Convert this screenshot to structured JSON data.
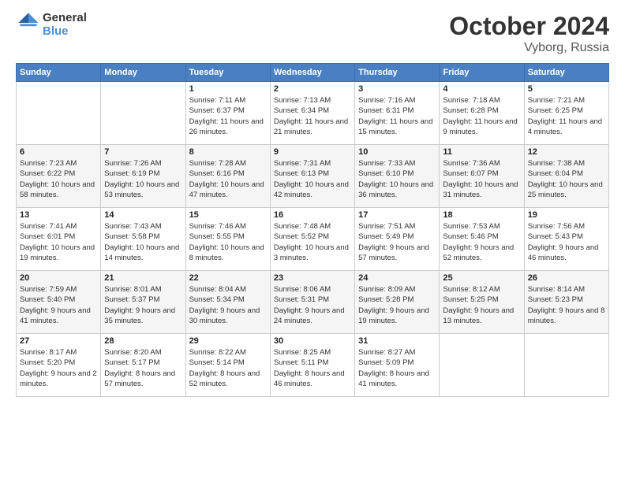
{
  "header": {
    "logo_line1": "General",
    "logo_line2": "Blue",
    "month": "October 2024",
    "location": "Vyborg, Russia"
  },
  "weekdays": [
    "Sunday",
    "Monday",
    "Tuesday",
    "Wednesday",
    "Thursday",
    "Friday",
    "Saturday"
  ],
  "weeks": [
    [
      {
        "day": "",
        "info": ""
      },
      {
        "day": "",
        "info": ""
      },
      {
        "day": "1",
        "info": "Sunrise: 7:11 AM\nSunset: 6:37 PM\nDaylight: 11 hours and 26 minutes."
      },
      {
        "day": "2",
        "info": "Sunrise: 7:13 AM\nSunset: 6:34 PM\nDaylight: 11 hours and 21 minutes."
      },
      {
        "day": "3",
        "info": "Sunrise: 7:16 AM\nSunset: 6:31 PM\nDaylight: 11 hours and 15 minutes."
      },
      {
        "day": "4",
        "info": "Sunrise: 7:18 AM\nSunset: 6:28 PM\nDaylight: 11 hours and 9 minutes."
      },
      {
        "day": "5",
        "info": "Sunrise: 7:21 AM\nSunset: 6:25 PM\nDaylight: 11 hours and 4 minutes."
      }
    ],
    [
      {
        "day": "6",
        "info": "Sunrise: 7:23 AM\nSunset: 6:22 PM\nDaylight: 10 hours and 58 minutes."
      },
      {
        "day": "7",
        "info": "Sunrise: 7:26 AM\nSunset: 6:19 PM\nDaylight: 10 hours and 53 minutes."
      },
      {
        "day": "8",
        "info": "Sunrise: 7:28 AM\nSunset: 6:16 PM\nDaylight: 10 hours and 47 minutes."
      },
      {
        "day": "9",
        "info": "Sunrise: 7:31 AM\nSunset: 6:13 PM\nDaylight: 10 hours and 42 minutes."
      },
      {
        "day": "10",
        "info": "Sunrise: 7:33 AM\nSunset: 6:10 PM\nDaylight: 10 hours and 36 minutes."
      },
      {
        "day": "11",
        "info": "Sunrise: 7:36 AM\nSunset: 6:07 PM\nDaylight: 10 hours and 31 minutes."
      },
      {
        "day": "12",
        "info": "Sunrise: 7:38 AM\nSunset: 6:04 PM\nDaylight: 10 hours and 25 minutes."
      }
    ],
    [
      {
        "day": "13",
        "info": "Sunrise: 7:41 AM\nSunset: 6:01 PM\nDaylight: 10 hours and 19 minutes."
      },
      {
        "day": "14",
        "info": "Sunrise: 7:43 AM\nSunset: 5:58 PM\nDaylight: 10 hours and 14 minutes."
      },
      {
        "day": "15",
        "info": "Sunrise: 7:46 AM\nSunset: 5:55 PM\nDaylight: 10 hours and 8 minutes."
      },
      {
        "day": "16",
        "info": "Sunrise: 7:48 AM\nSunset: 5:52 PM\nDaylight: 10 hours and 3 minutes."
      },
      {
        "day": "17",
        "info": "Sunrise: 7:51 AM\nSunset: 5:49 PM\nDaylight: 9 hours and 57 minutes."
      },
      {
        "day": "18",
        "info": "Sunrise: 7:53 AM\nSunset: 5:46 PM\nDaylight: 9 hours and 52 minutes."
      },
      {
        "day": "19",
        "info": "Sunrise: 7:56 AM\nSunset: 5:43 PM\nDaylight: 9 hours and 46 minutes."
      }
    ],
    [
      {
        "day": "20",
        "info": "Sunrise: 7:59 AM\nSunset: 5:40 PM\nDaylight: 9 hours and 41 minutes."
      },
      {
        "day": "21",
        "info": "Sunrise: 8:01 AM\nSunset: 5:37 PM\nDaylight: 9 hours and 35 minutes."
      },
      {
        "day": "22",
        "info": "Sunrise: 8:04 AM\nSunset: 5:34 PM\nDaylight: 9 hours and 30 minutes."
      },
      {
        "day": "23",
        "info": "Sunrise: 8:06 AM\nSunset: 5:31 PM\nDaylight: 9 hours and 24 minutes."
      },
      {
        "day": "24",
        "info": "Sunrise: 8:09 AM\nSunset: 5:28 PM\nDaylight: 9 hours and 19 minutes."
      },
      {
        "day": "25",
        "info": "Sunrise: 8:12 AM\nSunset: 5:25 PM\nDaylight: 9 hours and 13 minutes."
      },
      {
        "day": "26",
        "info": "Sunrise: 8:14 AM\nSunset: 5:23 PM\nDaylight: 9 hours and 8 minutes."
      }
    ],
    [
      {
        "day": "27",
        "info": "Sunrise: 8:17 AM\nSunset: 5:20 PM\nDaylight: 9 hours and 2 minutes."
      },
      {
        "day": "28",
        "info": "Sunrise: 8:20 AM\nSunset: 5:17 PM\nDaylight: 8 hours and 57 minutes."
      },
      {
        "day": "29",
        "info": "Sunrise: 8:22 AM\nSunset: 5:14 PM\nDaylight: 8 hours and 52 minutes."
      },
      {
        "day": "30",
        "info": "Sunrise: 8:25 AM\nSunset: 5:11 PM\nDaylight: 8 hours and 46 minutes."
      },
      {
        "day": "31",
        "info": "Sunrise: 8:27 AM\nSunset: 5:09 PM\nDaylight: 8 hours and 41 minutes."
      },
      {
        "day": "",
        "info": ""
      },
      {
        "day": "",
        "info": ""
      }
    ]
  ]
}
